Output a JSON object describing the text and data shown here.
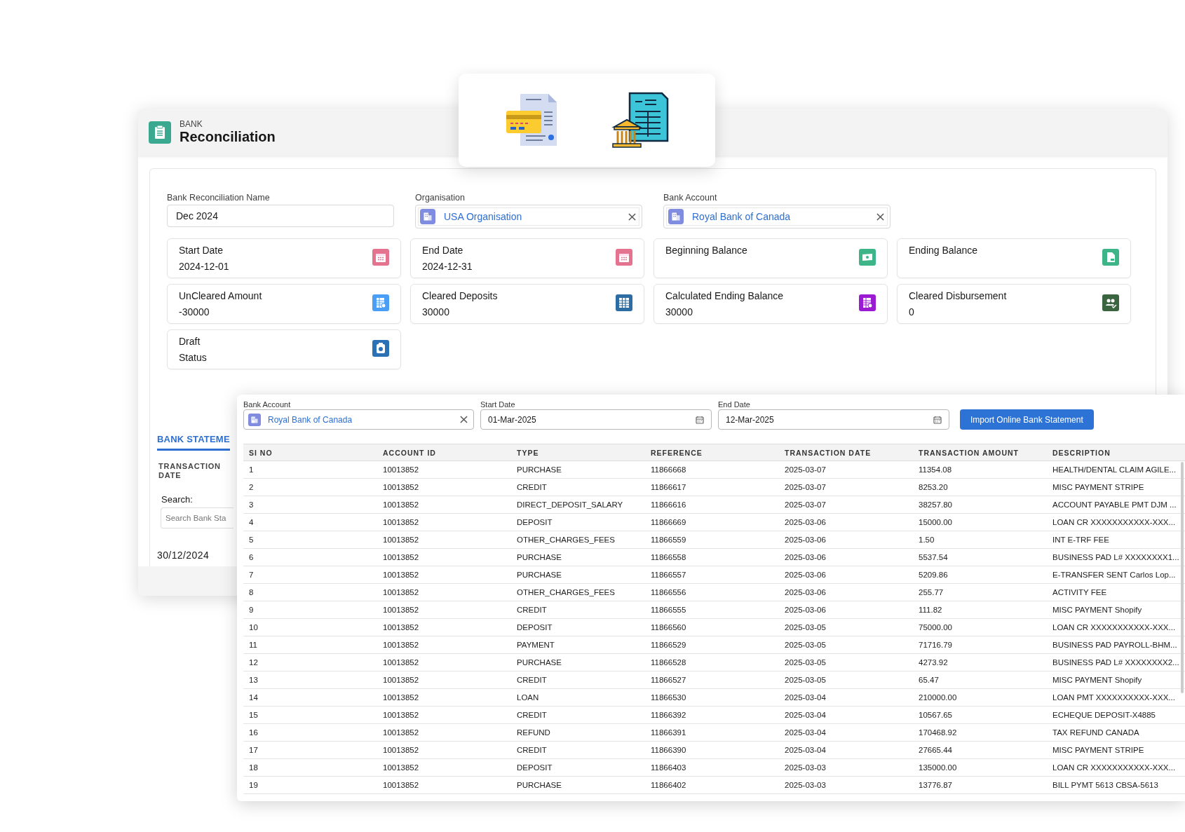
{
  "header": {
    "object_label": "BANK",
    "title": "Reconciliation"
  },
  "form": [
    {
      "kind": "text",
      "label": "Bank Reconciliation Name",
      "value": "Dec 2024"
    },
    {
      "kind": "lookup",
      "label": "Organisation",
      "value": "USA Organisation"
    },
    {
      "kind": "lookup",
      "label": "Bank Account",
      "value": "Royal Bank of Canada"
    }
  ],
  "summary_cards": [
    {
      "label": "Start Date",
      "value": "2024-12-01",
      "kind": "calendar",
      "color": "#e3738f"
    },
    {
      "label": "End Date",
      "value": "2024-12-31",
      "kind": "calendar",
      "color": "#e3738f"
    },
    {
      "label": "Beginning Balance",
      "kind": "cash",
      "color": "#3eb489"
    },
    {
      "label": "Ending Balance",
      "kind": "document",
      "color": "#3eb489"
    },
    {
      "label": "UnCleared Amount",
      "value": "-30000",
      "kind": "ledger",
      "color": "#4b9ef5"
    },
    {
      "label": "Cleared Deposits",
      "value": "30000",
      "kind": "grid",
      "color": "#2e6da4"
    },
    {
      "label": "Calculated Ending Balance",
      "value": "30000",
      "kind": "ledger",
      "color": "#9a1bd1"
    },
    {
      "label": "Cleared Disbursement",
      "value": "0",
      "kind": "people",
      "color": "#3b6440"
    },
    {
      "label": "Draft",
      "value": "Status",
      "kind": "record",
      "color": "#2a72b5"
    }
  ],
  "statement_section": {
    "tab": {
      "label": "BANK STATEME",
      "selected": true
    },
    "column_header": "TRANSACTION DATE",
    "search_label": "Search:",
    "search_placeholder": "Search Bank Sta",
    "first_date": "30/12/2024"
  },
  "import_panel": {
    "bank_account": {
      "label": "Bank Account",
      "value": "Royal Bank of Canada"
    },
    "start_date": {
      "label": "Start Date",
      "value": "01-Mar-2025"
    },
    "end_date": {
      "label": "End Date",
      "value": "12-Mar-2025"
    },
    "button": "Import Online Bank Statement"
  },
  "table": {
    "columns": [
      "SI NO",
      "ACCOUNT ID",
      "TYPE",
      "REFERENCE",
      "TRANSACTION DATE",
      "TRANSACTION AMOUNT",
      "DESCRIPTION"
    ],
    "rows": [
      [
        "1",
        "10013852",
        "PURCHASE",
        "11866668",
        "2025-03-07",
        "11354.08",
        "HEALTH/DENTAL CLAIM AGILE..."
      ],
      [
        "2",
        "10013852",
        "CREDIT",
        "11866617",
        "2025-03-07",
        "8253.20",
        "MISC PAYMENT STRIPE"
      ],
      [
        "3",
        "10013852",
        "DIRECT_DEPOSIT_SALARY",
        "11866616",
        "2025-03-07",
        "38257.80",
        "ACCOUNT PAYABLE PMT DJM ..."
      ],
      [
        "4",
        "10013852",
        "DEPOSIT",
        "11866669",
        "2025-03-06",
        "15000.00",
        "LOAN CR XXXXXXXXXXX-XXX..."
      ],
      [
        "5",
        "10013852",
        "OTHER_CHARGES_FEES",
        "11866559",
        "2025-03-06",
        "1.50",
        "INT E-TRF FEE"
      ],
      [
        "6",
        "10013852",
        "PURCHASE",
        "11866558",
        "2025-03-06",
        "5537.54",
        "BUSINESS PAD L# XXXXXXXX1..."
      ],
      [
        "7",
        "10013852",
        "PURCHASE",
        "11866557",
        "2025-03-06",
        "5209.86",
        "E-TRANSFER SENT Carlos Lop..."
      ],
      [
        "8",
        "10013852",
        "OTHER_CHARGES_FEES",
        "11866556",
        "2025-03-06",
        "255.77",
        "ACTIVITY FEE"
      ],
      [
        "9",
        "10013852",
        "CREDIT",
        "11866555",
        "2025-03-06",
        "111.82",
        "MISC PAYMENT Shopify"
      ],
      [
        "10",
        "10013852",
        "DEPOSIT",
        "11866560",
        "2025-03-05",
        "75000.00",
        "LOAN CR XXXXXXXXXXX-XXX..."
      ],
      [
        "11",
        "10013852",
        "PAYMENT",
        "11866529",
        "2025-03-05",
        "71716.79",
        "BUSINESS PAD PAYROLL-BHM..."
      ],
      [
        "12",
        "10013852",
        "PURCHASE",
        "11866528",
        "2025-03-05",
        "4273.92",
        "BUSINESS PAD L# XXXXXXXX2..."
      ],
      [
        "13",
        "10013852",
        "CREDIT",
        "11866527",
        "2025-03-05",
        "65.47",
        "MISC PAYMENT Shopify"
      ],
      [
        "14",
        "10013852",
        "LOAN",
        "11866530",
        "2025-03-04",
        "210000.00",
        "LOAN PMT XXXXXXXXXX-XXX..."
      ],
      [
        "15",
        "10013852",
        "CREDIT",
        "11866392",
        "2025-03-04",
        "10567.65",
        "ECHEQUE DEPOSIT-X4885"
      ],
      [
        "16",
        "10013852",
        "REFUND",
        "11866391",
        "2025-03-04",
        "170468.92",
        "TAX REFUND CANADA"
      ],
      [
        "17",
        "10013852",
        "CREDIT",
        "11866390",
        "2025-03-04",
        "27665.44",
        "MISC PAYMENT STRIPE"
      ],
      [
        "18",
        "10013852",
        "DEPOSIT",
        "11866403",
        "2025-03-03",
        "135000.00",
        "LOAN CR XXXXXXXXXXX-XXX..."
      ],
      [
        "19",
        "10013852",
        "PURCHASE",
        "11866402",
        "2025-03-03",
        "13776.87",
        "BILL PYMT 5613 CBSA-5613"
      ]
    ]
  }
}
